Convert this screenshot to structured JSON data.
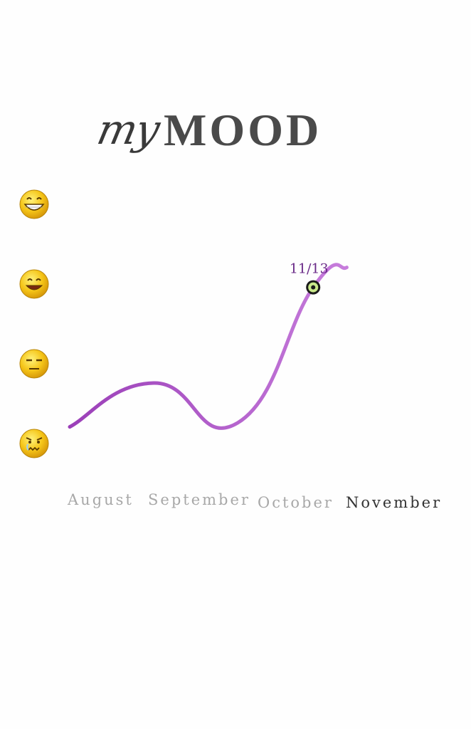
{
  "title": {
    "prefix": "my",
    "main": "MOOD"
  },
  "mood_levels": [
    {
      "name": "grinning",
      "icon": "grinning-face-icon"
    },
    {
      "name": "happy",
      "icon": "smiling-face-icon"
    },
    {
      "name": "neutral",
      "icon": "expressionless-face-icon"
    },
    {
      "name": "sad",
      "icon": "worried-face-icon"
    }
  ],
  "chart_data": {
    "type": "line",
    "categories": [
      "August",
      "September",
      "October",
      "November"
    ],
    "active_category": "November",
    "y_scale": [
      "sad",
      "neutral",
      "happy",
      "grinning"
    ],
    "ylim": [
      0,
      3
    ],
    "series": [
      {
        "x": [
          0,
          1,
          2,
          2.9,
          3.3
        ],
        "values": [
          0.2,
          0.75,
          0.25,
          1.95,
          2.2
        ]
      }
    ],
    "highlight": {
      "label": "11/13",
      "x": 2.9,
      "value": 1.95
    },
    "line_color_start": "#9b3fb8",
    "line_color_end": "#c77ddc",
    "marker_fill": "#c9e88a",
    "grid": false
  }
}
